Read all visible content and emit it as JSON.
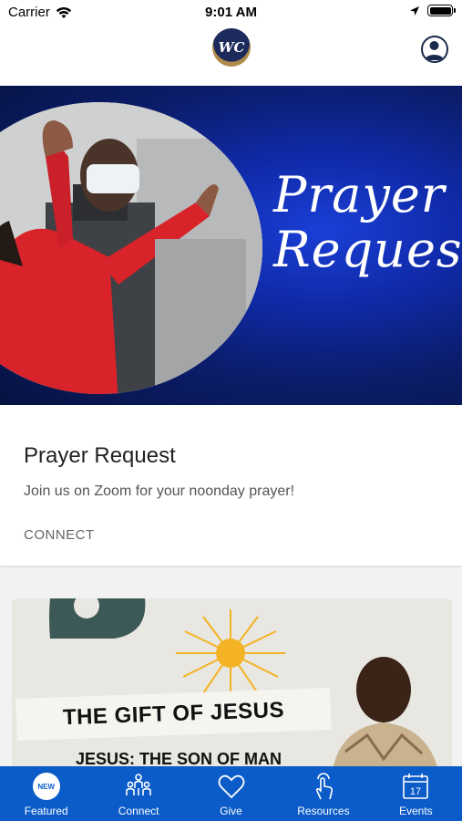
{
  "status_bar": {
    "carrier": "Carrier",
    "time": "9:01 AM"
  },
  "header": {
    "logo_text": "WC"
  },
  "banner": {
    "title_line1": "Prayer",
    "title_line2": "Request"
  },
  "card": {
    "title": "Prayer Request",
    "description": "Join us on Zoom for your noonday prayer!",
    "action": "CONNECT"
  },
  "promo": {
    "headline": "THE GIFT OF JESUS",
    "subline": "JESUS: THE SON OF MAN"
  },
  "tabs": [
    {
      "label": "Featured",
      "icon": "new-badge-icon",
      "badge": "NEW"
    },
    {
      "label": "Connect",
      "icon": "people-icon"
    },
    {
      "label": "Give",
      "icon": "heart-icon"
    },
    {
      "label": "Resources",
      "icon": "tap-hand-icon"
    },
    {
      "label": "Events",
      "icon": "calendar-icon",
      "day": "17"
    }
  ],
  "colors": {
    "tab_bar": "#0b5cc8",
    "banner_blue": "#0f2aa8"
  }
}
